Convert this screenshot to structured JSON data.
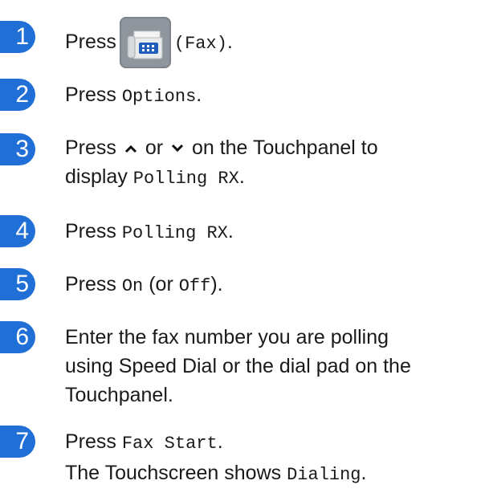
{
  "steps": [
    {
      "number": "1",
      "press": "Press",
      "fax_label": "(Fax)",
      "end": "."
    },
    {
      "number": "2",
      "press": "Press",
      "option": "Options",
      "end": "."
    },
    {
      "number": "3",
      "press": "Press",
      "or": "or",
      "on_panel": "on the Touchpanel to",
      "display": "display",
      "polling": "Polling RX",
      "end": "."
    },
    {
      "number": "4",
      "press": "Press",
      "polling": "Polling RX",
      "end": "."
    },
    {
      "number": "5",
      "press": "Press",
      "on": "On",
      "or_open": "(or",
      "off": "Off",
      "close": ")."
    },
    {
      "number": "6",
      "line1": "Enter the fax number you are polling",
      "line2": "using Speed Dial or the dial pad on the",
      "line3": "Touchpanel."
    },
    {
      "number": "7",
      "press": "Press",
      "fax_start": "Fax Start",
      "end": ".",
      "line2_pre": "The Touchscreen shows",
      "dialing": "Dialing",
      "line2_end": "."
    }
  ],
  "icons": {
    "fax": "fax-icon",
    "up": "chevron-up-icon",
    "down": "chevron-down-icon"
  },
  "colors": {
    "step_badge": "#1f6fd6",
    "fax_button": "#8f969e"
  }
}
